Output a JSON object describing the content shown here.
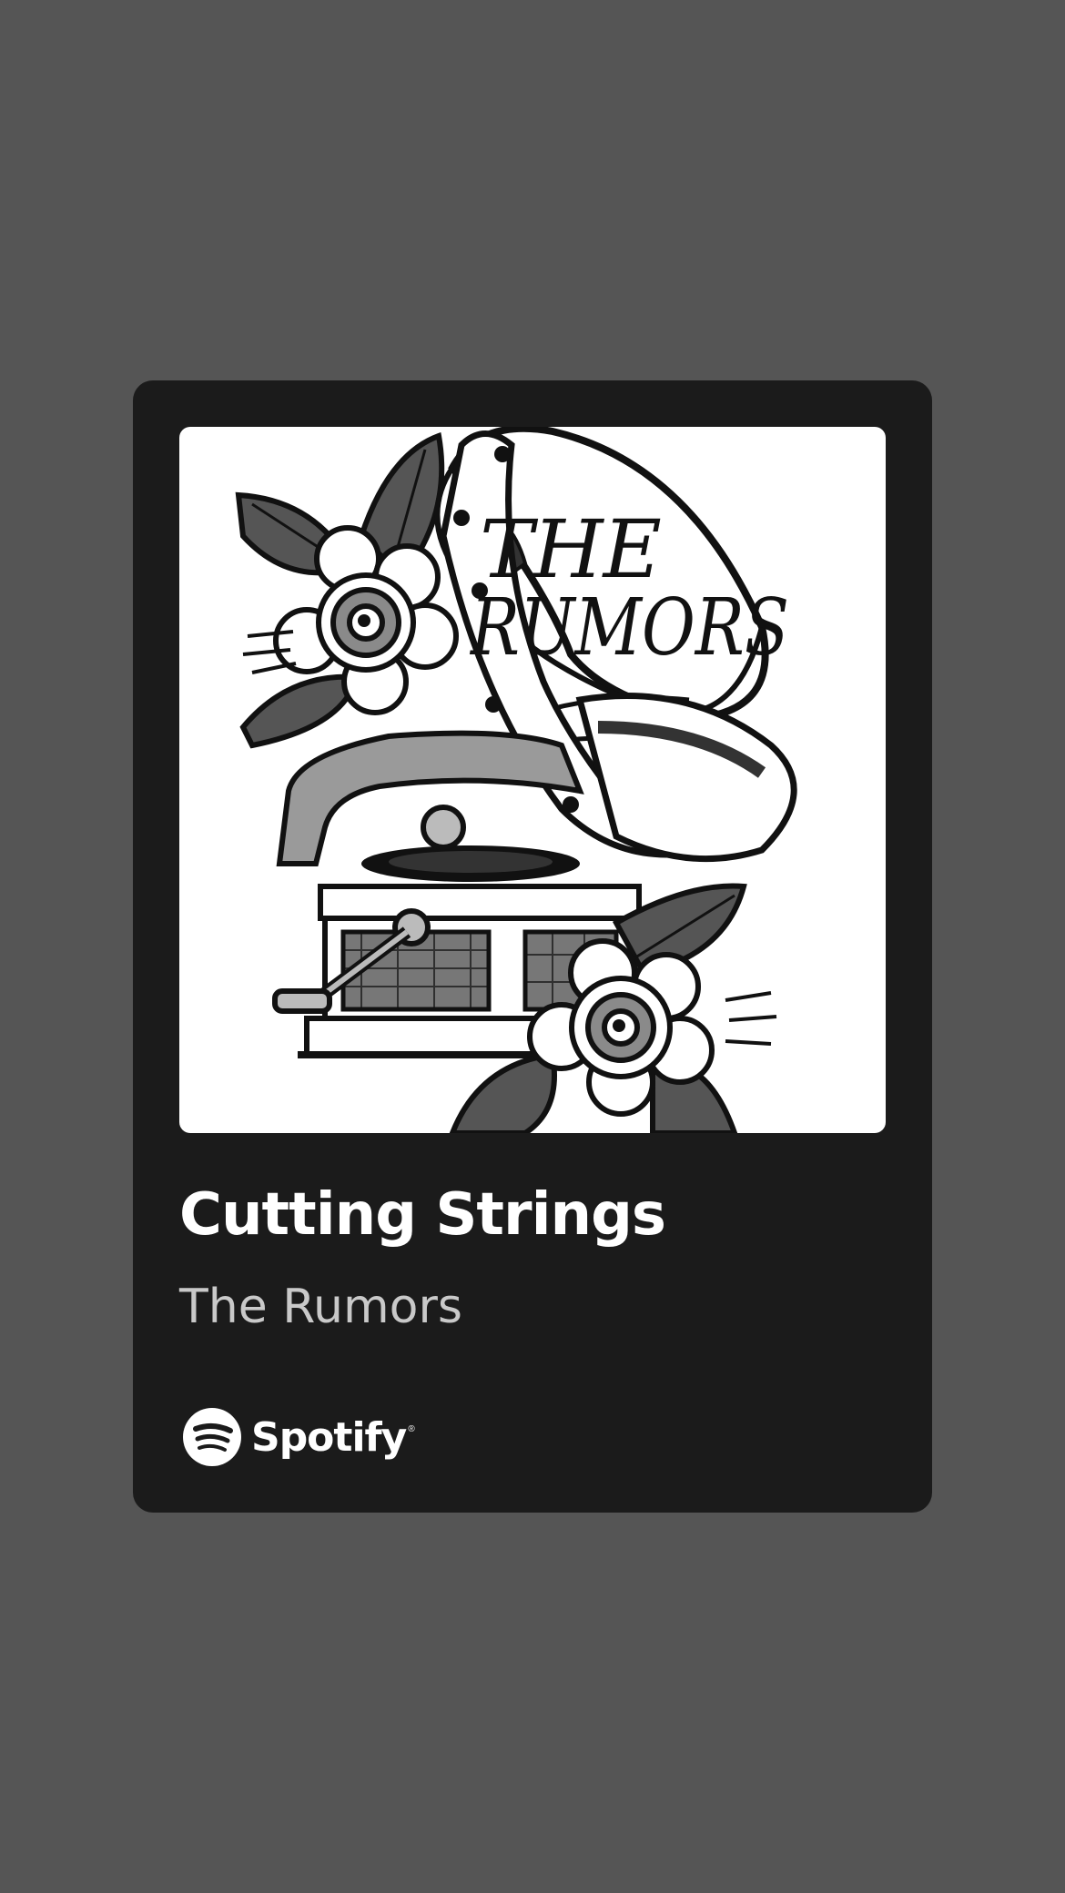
{
  "track": {
    "title": "Cutting Strings",
    "artist": "The Rumors"
  },
  "artwork": {
    "logo_text_line1": "THE",
    "logo_text_line2": "RUMORS"
  },
  "brand": {
    "name": "Spotify",
    "registered_mark": "®",
    "icon": "spotify-logo-icon"
  },
  "colors": {
    "background": "#555555",
    "card": "#1b1b1b",
    "title": "#ffffff",
    "subtitle": "#c9c9c9"
  }
}
